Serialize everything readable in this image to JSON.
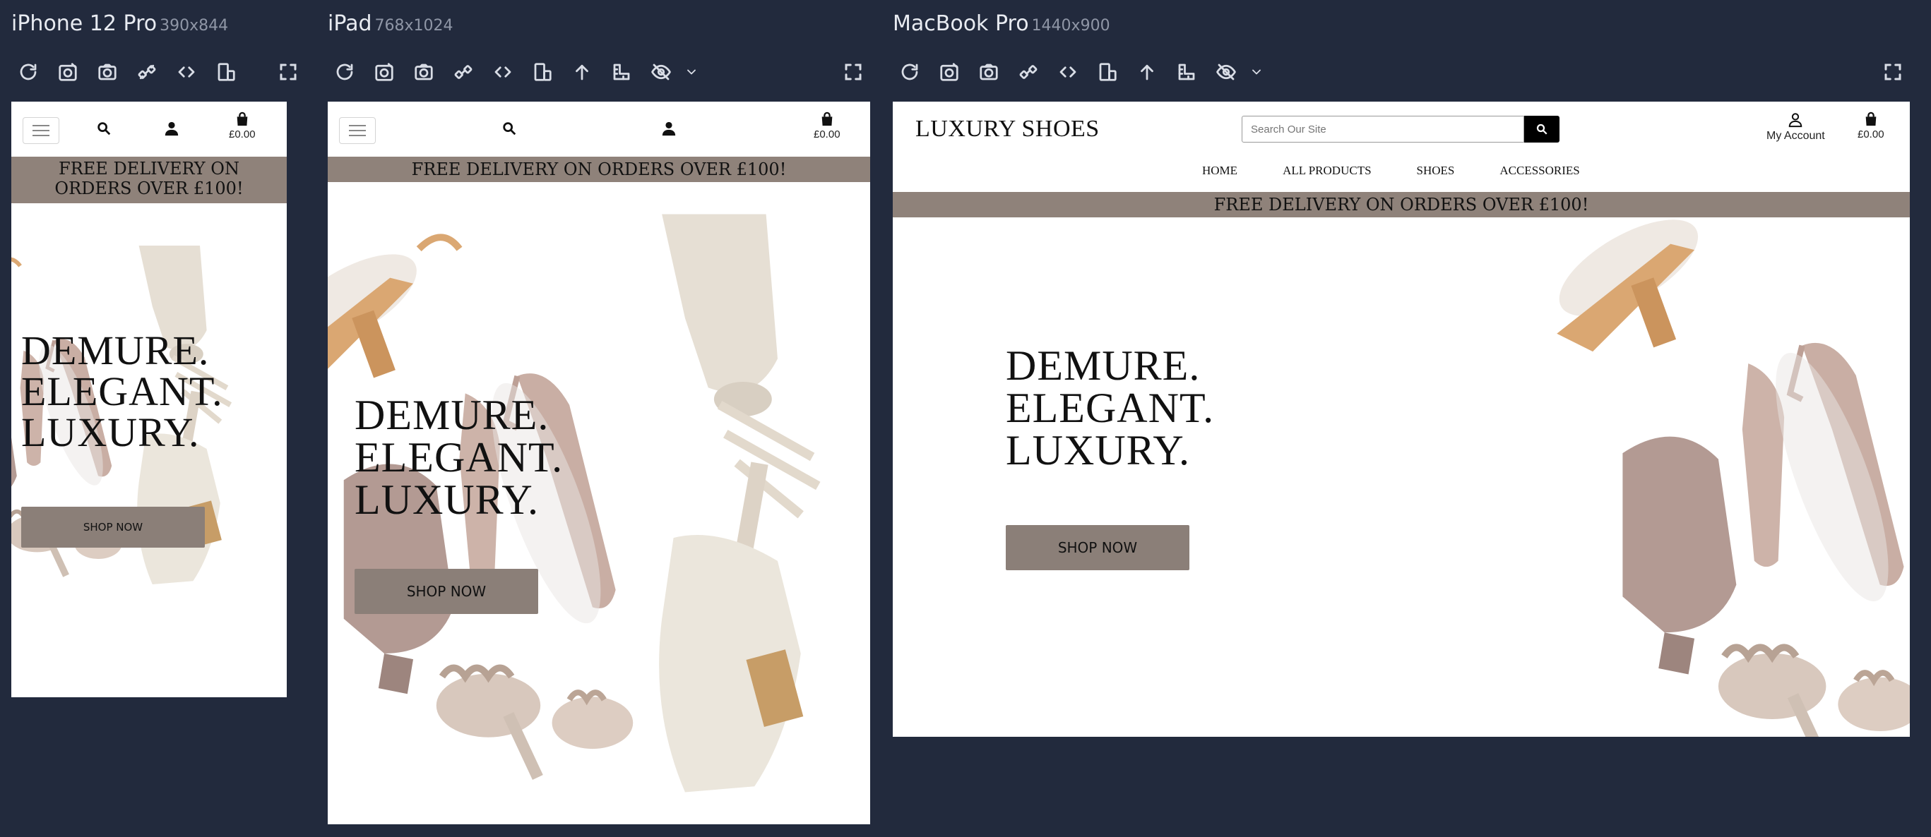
{
  "devices": [
    {
      "name": "iPhone 12 Pro",
      "size": "390x844"
    },
    {
      "name": "iPad",
      "size": "768x1024"
    },
    {
      "name": "MacBook Pro",
      "size": "1440x900"
    }
  ],
  "toolbar_icons": [
    "refresh-icon",
    "screenshot-full-icon",
    "camera-icon",
    "sync-scroll-icon",
    "code-icon",
    "rotate-icon",
    "scroll-top-icon",
    "ruler-icon",
    "visibility-off-icon",
    "chevron-down-icon",
    "fullscreen-icon"
  ],
  "site": {
    "logo": "LUXURY SHOES",
    "search_placeholder": "Search Our Site",
    "nav": [
      "HOME",
      "ALL PRODUCTS",
      "SHOES",
      "ACCESSORIES"
    ],
    "account_label": "My Account",
    "cart_total": "£0.00",
    "banner": "FREE DELIVERY ON ORDERS OVER £100!",
    "headline": [
      "DEMURE.",
      "ELEGANT.",
      "LUXURY."
    ],
    "cta": "SHOP NOW"
  },
  "colors": {
    "background": "#222a3d",
    "banner": "#8f827a",
    "cta": "#8b7f78"
  }
}
